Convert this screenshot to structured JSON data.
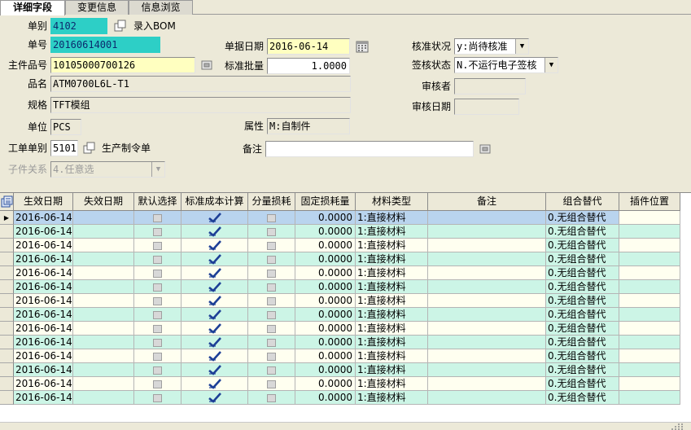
{
  "tabs": [
    "详细字段",
    "变更信息",
    "信息浏览"
  ],
  "form": {
    "doc_type": {
      "label": "单别",
      "value": "4102"
    },
    "input_bom": {
      "label": "录入BOM"
    },
    "doc_no": {
      "label": "单号",
      "value": "20160614001"
    },
    "doc_date": {
      "label": "单据日期",
      "value": "2016-06-14"
    },
    "approval_status": {
      "label": "核准状况",
      "value": "y:尚待核准"
    },
    "main_item_no": {
      "label": "主件品号",
      "value": "10105000700126"
    },
    "std_batch": {
      "label": "标准批量",
      "value": "1.0000"
    },
    "sign_status": {
      "label": "签核状态",
      "value": "N.不运行电子签核"
    },
    "item_name": {
      "label": "品名",
      "value": "ATM0700L6L-T1"
    },
    "reviewer": {
      "label": "审核者",
      "value": ""
    },
    "spec": {
      "label": "规格",
      "value": "TFT模组"
    },
    "review_date": {
      "label": "审核日期",
      "value": ""
    },
    "unit": {
      "label": "单位",
      "value": "PCS"
    },
    "attribute": {
      "label": "属性",
      "value": "M:自制件"
    },
    "work_doc_type": {
      "label": "工单单别",
      "value": "5101"
    },
    "production_order": {
      "label": "生产制令单"
    },
    "remark": {
      "label": "备注",
      "value": ""
    },
    "sub_relation": {
      "label": "子件关系",
      "value": "4.任意选"
    }
  },
  "grid": {
    "columns": [
      "生效日期",
      "失效日期",
      "默认选择",
      "标准成本计算",
      "分量损耗",
      "固定损耗量",
      "材料类型",
      "备注",
      "组合替代",
      "插件位置"
    ],
    "rows": [
      {
        "eff_date": "2016-06-14",
        "exp_date": "",
        "default": false,
        "std_cost": true,
        "frac_loss": false,
        "fixed_loss": "0.0000",
        "mat_type": "1:直接材料",
        "remark": "",
        "combo": "0.无组合替代",
        "pos": ""
      },
      {
        "eff_date": "2016-06-14",
        "exp_date": "",
        "default": false,
        "std_cost": true,
        "frac_loss": false,
        "fixed_loss": "0.0000",
        "mat_type": "1:直接材料",
        "remark": "",
        "combo": "0.无组合替代",
        "pos": ""
      },
      {
        "eff_date": "2016-06-14",
        "exp_date": "",
        "default": false,
        "std_cost": true,
        "frac_loss": false,
        "fixed_loss": "0.0000",
        "mat_type": "1:直接材料",
        "remark": "",
        "combo": "0.无组合替代",
        "pos": ""
      },
      {
        "eff_date": "2016-06-14",
        "exp_date": "",
        "default": false,
        "std_cost": true,
        "frac_loss": false,
        "fixed_loss": "0.0000",
        "mat_type": "1:直接材料",
        "remark": "",
        "combo": "0.无组合替代",
        "pos": ""
      },
      {
        "eff_date": "2016-06-14",
        "exp_date": "",
        "default": false,
        "std_cost": true,
        "frac_loss": false,
        "fixed_loss": "0.0000",
        "mat_type": "1:直接材料",
        "remark": "",
        "combo": "0.无组合替代",
        "pos": ""
      },
      {
        "eff_date": "2016-06-14",
        "exp_date": "",
        "default": false,
        "std_cost": true,
        "frac_loss": false,
        "fixed_loss": "0.0000",
        "mat_type": "1:直接材料",
        "remark": "",
        "combo": "0.无组合替代",
        "pos": ""
      },
      {
        "eff_date": "2016-06-14",
        "exp_date": "",
        "default": false,
        "std_cost": true,
        "frac_loss": false,
        "fixed_loss": "0.0000",
        "mat_type": "1:直接材料",
        "remark": "",
        "combo": "0.无组合替代",
        "pos": ""
      },
      {
        "eff_date": "2016-06-14",
        "exp_date": "",
        "default": false,
        "std_cost": true,
        "frac_loss": false,
        "fixed_loss": "0.0000",
        "mat_type": "1:直接材料",
        "remark": "",
        "combo": "0.无组合替代",
        "pos": ""
      },
      {
        "eff_date": "2016-06-14",
        "exp_date": "",
        "default": false,
        "std_cost": true,
        "frac_loss": false,
        "fixed_loss": "0.0000",
        "mat_type": "1:直接材料",
        "remark": "",
        "combo": "0.无组合替代",
        "pos": ""
      },
      {
        "eff_date": "2016-06-14",
        "exp_date": "",
        "default": false,
        "std_cost": true,
        "frac_loss": false,
        "fixed_loss": "0.0000",
        "mat_type": "1:直接材料",
        "remark": "",
        "combo": "0.无组合替代",
        "pos": ""
      },
      {
        "eff_date": "2016-06-14",
        "exp_date": "",
        "default": false,
        "std_cost": true,
        "frac_loss": false,
        "fixed_loss": "0.0000",
        "mat_type": "1:直接材料",
        "remark": "",
        "combo": "0.无组合替代",
        "pos": ""
      },
      {
        "eff_date": "2016-06-14",
        "exp_date": "",
        "default": false,
        "std_cost": true,
        "frac_loss": false,
        "fixed_loss": "0.0000",
        "mat_type": "1:直接材料",
        "remark": "",
        "combo": "0.无组合替代",
        "pos": ""
      },
      {
        "eff_date": "2016-06-14",
        "exp_date": "",
        "default": false,
        "std_cost": true,
        "frac_loss": false,
        "fixed_loss": "0.0000",
        "mat_type": "1:直接材料",
        "remark": "",
        "combo": "0.无组合替代",
        "pos": ""
      },
      {
        "eff_date": "2016-06-14",
        "exp_date": "",
        "default": false,
        "std_cost": true,
        "frac_loss": false,
        "fixed_loss": "0.0000",
        "mat_type": "1:直接材料",
        "remark": "",
        "combo": "0.无组合替代",
        "pos": ""
      }
    ],
    "selected_row": 0
  },
  "colors": {
    "accent_cyan": "#2dcfc6",
    "required_yellow": "#ffffc0",
    "row_alt_green": "#ccf5e6",
    "row_light": "#fffff0",
    "row_selected": "#b9d4ee",
    "tick_blue": "#1d3f96"
  }
}
